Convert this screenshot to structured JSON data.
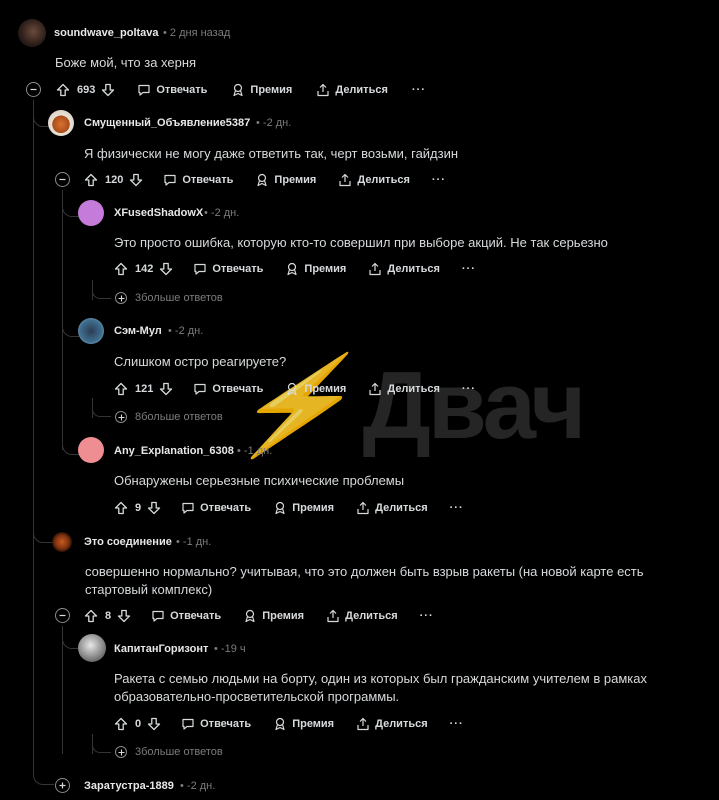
{
  "watermark": "Двач",
  "labels": {
    "reply": "Отвечать",
    "award": "Премия",
    "share": "Делиться",
    "more": "···"
  },
  "comments": [
    {
      "author": "soundwave_poltava",
      "time": "• 2 дня назад",
      "text": "Боже мой, что за херня",
      "score": "693"
    },
    {
      "author": "Смущенный_Объявление5387",
      "time": "• -2 дн.",
      "text": "Я физически не могу даже ответить так, черт возьми, гайдзин",
      "score": "120"
    },
    {
      "author": "XFusedShadowX",
      "time": "• -2 дн.",
      "text": "Это просто ошибка, которую кто-то совершил при выборе акций. Не так серьезно",
      "score": "142",
      "more": "3больше ответов"
    },
    {
      "author": "Сэм-Мул",
      "time": "• -2 дн.",
      "text": "Слишком остро реагируете?",
      "score": "121",
      "more": "8больше ответов"
    },
    {
      "author": "Any_Explanation_6308",
      "time": "• -1 дн.",
      "text": "Обнаружены серьезные психические проблемы",
      "score": "9"
    },
    {
      "author": "Это соединение",
      "time": "• -1 дн.",
      "text": "совершенно нормально? учитывая, что это должен быть взрыв ракеты (на новой карте есть стартовый комплекс)",
      "score": "8"
    },
    {
      "author": "КапитанГоризонт",
      "time": "• -19 ч",
      "text": "Ракета с семью людьми на борту, один из которых был гражданским учителем в рамках образовательно-просветительской программы.",
      "score": "0",
      "more": "3больше ответов"
    },
    {
      "author": "Заратустра-1889",
      "time": "• -2 дн."
    }
  ]
}
